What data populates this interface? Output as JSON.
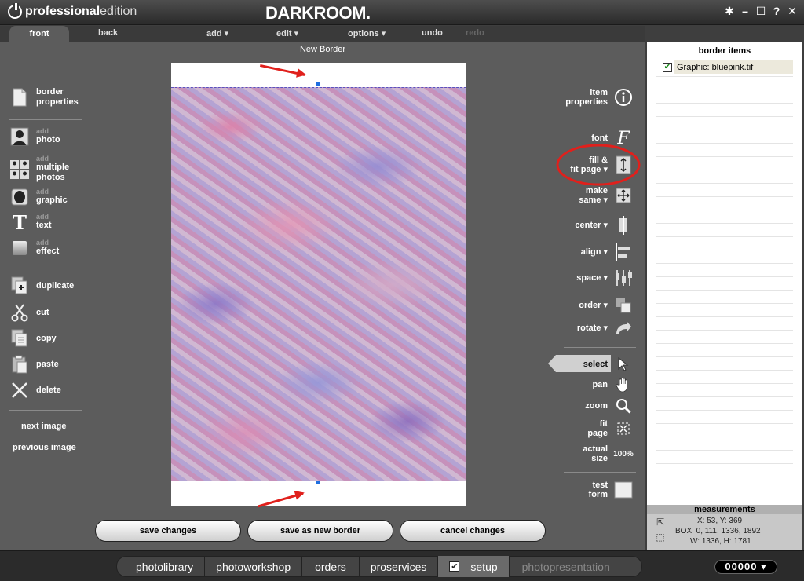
{
  "titlebar": {
    "brand_bold": "professional",
    "brand_light": "edition",
    "app_name": "DARKROOM.",
    "controls": [
      "✱",
      "–",
      "☐",
      "?",
      "✕"
    ]
  },
  "menu": {
    "front": "front",
    "back": "back",
    "add": "add ▾",
    "edit": "edit ▾",
    "options": "options ▾",
    "undo": "undo",
    "redo": "redo"
  },
  "document": {
    "title": "New Border"
  },
  "left_tools": {
    "border_properties": [
      "border",
      "properties"
    ],
    "add_prefix": "add",
    "photo": "photo",
    "multiple_photos": [
      "multiple",
      "photos"
    ],
    "graphic": "graphic",
    "text": "text",
    "effect": "effect",
    "duplicate": "duplicate",
    "cut": "cut",
    "copy": "copy",
    "paste": "paste",
    "delete": "delete",
    "next_image": "next image",
    "previous_image": "previous image"
  },
  "right_tools": {
    "item_properties": [
      "item",
      "properties"
    ],
    "font": "font",
    "fill_fit_page": [
      "fill &",
      "fit page ▾"
    ],
    "make_same": [
      "make",
      "same ▾"
    ],
    "center": "center ▾",
    "align": "align ▾",
    "space": "space ▾",
    "order": "order ▾",
    "rotate": "rotate ▾",
    "select": "select",
    "pan": "pan",
    "zoom": "zoom",
    "fit_page": [
      "fit",
      "page"
    ],
    "actual_size": [
      "actual",
      "size"
    ],
    "actual_size_value": "100%",
    "test_form": [
      "test",
      "form"
    ]
  },
  "actions": {
    "save_changes": "save changes",
    "save_as_new_border": "save as new border",
    "cancel_changes": "cancel changes"
  },
  "panel": {
    "title": "border items",
    "items": [
      {
        "label": "Graphic: bluepink.tif",
        "checked": true
      }
    ]
  },
  "measurements": {
    "title": "measurements",
    "position": "X: 53, Y: 369",
    "box": "BOX: 0, 111, 1336, 1892",
    "size": "W: 1336, H: 1781"
  },
  "nav": {
    "tabs": [
      "photolibrary",
      "photoworkshop",
      "orders",
      "proservices",
      "setup",
      "photopresentation"
    ],
    "active": "setup",
    "counter": "00000 ▾"
  },
  "colors": {
    "accent_red": "#e0201c",
    "handle_blue": "#1f6fe0",
    "canvas_gray": "#5c5c5c"
  }
}
